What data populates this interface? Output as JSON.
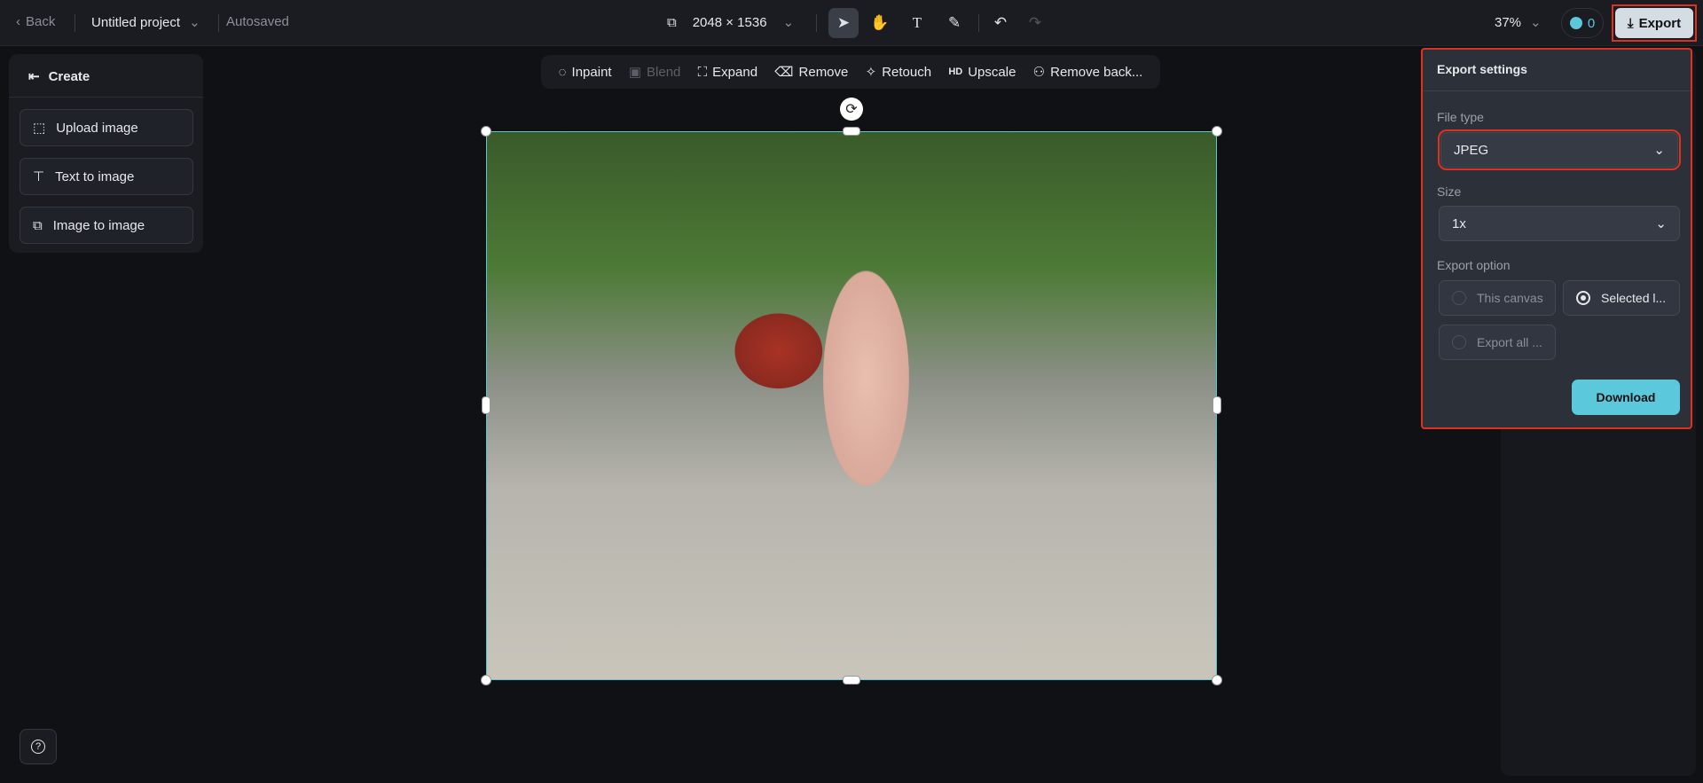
{
  "topbar": {
    "back": "Back",
    "project": "Untitled project",
    "status": "Autosaved",
    "dimensions": "2048 × 1536",
    "zoom": "37%",
    "credits": "0",
    "export": "Export"
  },
  "left_panel": {
    "title": "Create",
    "items": [
      {
        "label": "Upload image"
      },
      {
        "label": "Text to image"
      },
      {
        "label": "Image to image"
      }
    ]
  },
  "toolbar": {
    "items": [
      {
        "label": "Inpaint",
        "icon": "inpaint-icon"
      },
      {
        "label": "Blend",
        "icon": "blend-icon",
        "disabled": true
      },
      {
        "label": "Expand",
        "icon": "expand-icon"
      },
      {
        "label": "Remove",
        "icon": "eraser-icon"
      },
      {
        "label": "Retouch",
        "icon": "retouch-icon"
      },
      {
        "label": "Upscale",
        "icon": "hd-icon",
        "icon_text": "HD"
      },
      {
        "label": "Remove back...",
        "icon": "remove-background-icon"
      }
    ]
  },
  "export_panel": {
    "title": "Export settings",
    "file_type_label": "File type",
    "file_type": "JPEG",
    "size_label": "Size",
    "size": "1x",
    "option_label": "Export option",
    "options": [
      {
        "label": "This canvas",
        "selected": false
      },
      {
        "label": "Selected l...",
        "selected": true
      },
      {
        "label": "Export all ...",
        "selected": false
      }
    ],
    "download": "Download"
  },
  "colors": {
    "accent": "#5bc8dc",
    "highlight": "#e0301e"
  }
}
